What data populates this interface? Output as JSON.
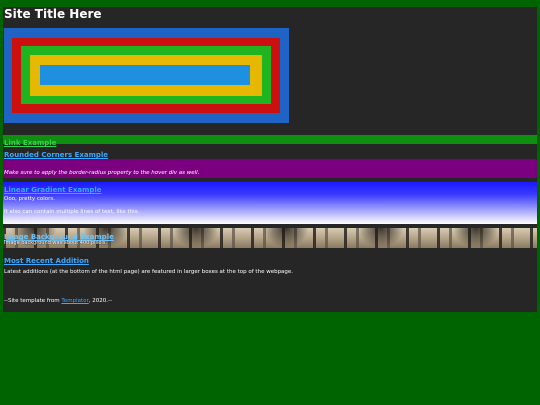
{
  "header": {
    "site_title": "Site Title Here"
  },
  "nested_boxes": {
    "colors": [
      "#1f63c4",
      "#cc0f0f",
      "#1fb420",
      "#e6b800",
      "#1e90e0"
    ]
  },
  "link_example": {
    "label": "Link Example"
  },
  "rounded_corners": {
    "heading": "Rounded Corners Example",
    "text": "Make sure to apply the border-radius property to the hover div as well."
  },
  "linear_gradient": {
    "heading": "Linear Gradient Example",
    "line1": "Ooo, pretty colors.",
    "line2": "It also can contain multiple lines of text, like this."
  },
  "image_section": {
    "heading": "Image Background Example",
    "text": "Image background was about 400 pixels."
  },
  "recent": {
    "heading": "Most Recent Addition",
    "text": "Latest additions (at the bottom of the html page) are featured in larger boxes at the top of the webpage."
  },
  "footer": {
    "prefix": "--Site template from ",
    "link": "Templator",
    "suffix": ", 2020.--"
  }
}
